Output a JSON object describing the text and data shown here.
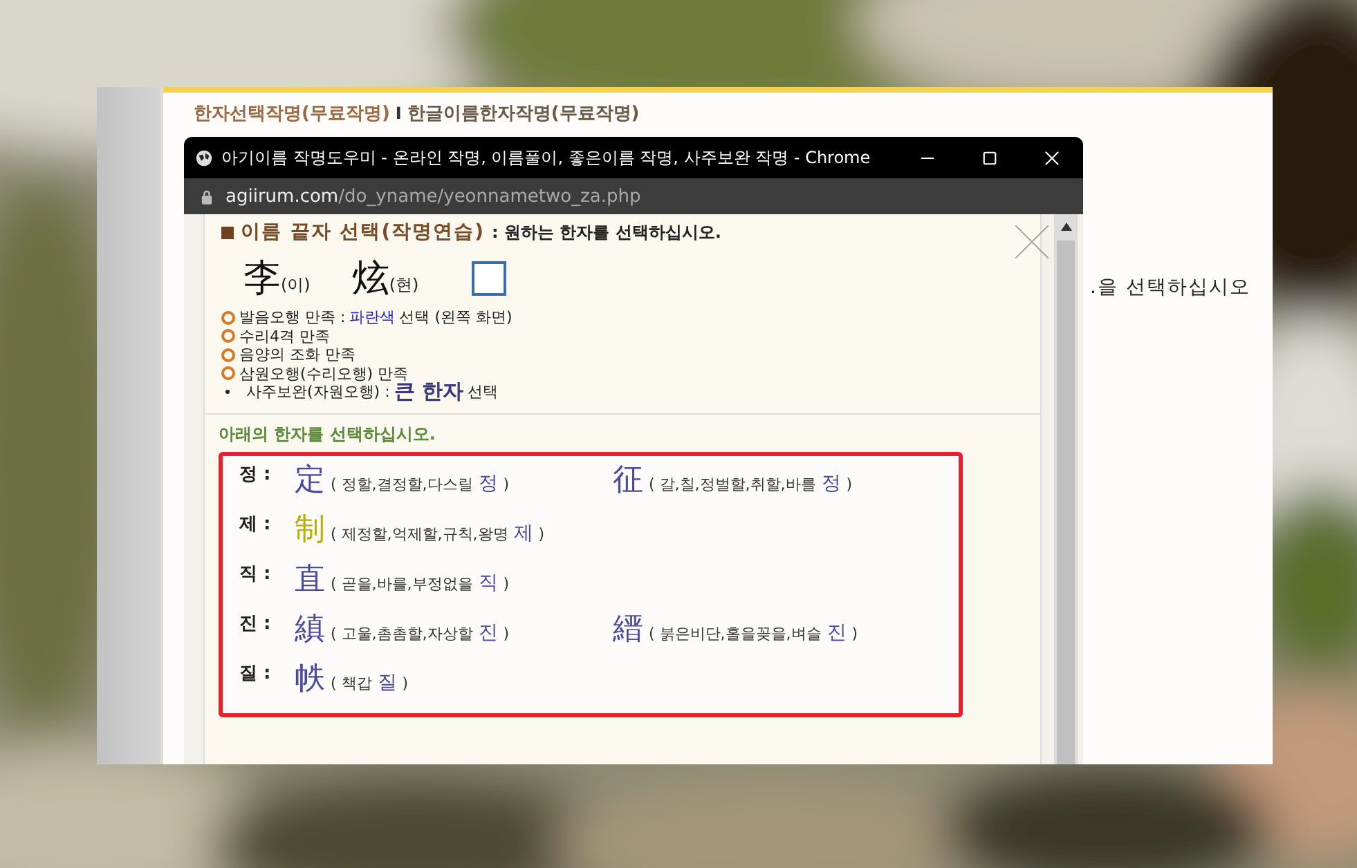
{
  "page_links": [
    {
      "label": "한자선택작명(무료작명)",
      "selected": true
    },
    {
      "label": "한글이름한자작명(무료작명)",
      "selected": false
    }
  ],
  "link_separator": "I",
  "page_side_text": ".을 선택하십시오",
  "popup": {
    "title": "아기이름 작명도우미 - 온라인 작명, 이름풀이, 좋은이름 작명, 사주보완 작명 - Chrome",
    "url_host": "agiirum.com",
    "url_path": "/do_yname/yeonnametwo_za.php"
  },
  "heading": {
    "title": "이름 끝자 선택(작명연습)",
    "subtitle": ": 원하는 한자를 선택하십시오."
  },
  "name_chars": [
    {
      "kind": "hanja",
      "hanja": "李",
      "reading": "(이)"
    },
    {
      "kind": "hanja",
      "hanja": "炫",
      "reading": "(현)"
    },
    {
      "kind": "empty"
    }
  ],
  "criteria": [
    {
      "kind": "circle",
      "parts": [
        {
          "kind": "plain",
          "text": "발음오행 만족 :"
        },
        {
          "kind": "blue",
          "text": "파란색"
        },
        {
          "kind": "plain",
          "text": "선택 (왼쪽 화면)"
        }
      ]
    },
    {
      "kind": "circle",
      "parts": [
        {
          "kind": "plain",
          "text": "수리4격 만족"
        }
      ]
    },
    {
      "kind": "circle",
      "parts": [
        {
          "kind": "plain",
          "text": "음양의 조화 만족"
        }
      ]
    },
    {
      "kind": "circle",
      "parts": [
        {
          "kind": "plain",
          "text": "삼원오행(수리오행) 만족"
        }
      ]
    },
    {
      "kind": "bullet",
      "parts": [
        {
          "kind": "plain",
          "text": "사주보완(자원오행) :"
        },
        {
          "kind": "large",
          "text": "큰 한자"
        },
        {
          "kind": "plain",
          "text": "선택"
        }
      ]
    }
  ],
  "list_heading": "아래의 한자를 선택하십시오.",
  "groups": [
    {
      "reading": "정 :",
      "options": [
        {
          "hanja": "定",
          "meaning": "( 정할,결정할,다스릴",
          "sound": "정",
          "close": ")",
          "color": "#4b4b9c"
        },
        {
          "hanja": "征",
          "meaning": "( 갈,칠,정벌할,취할,바를",
          "sound": "정",
          "close": ")",
          "color": "#4b4b9c"
        }
      ]
    },
    {
      "reading": "제 :",
      "options": [
        {
          "hanja": "制",
          "meaning": "( 제정할,억제할,규칙,왕명",
          "sound": "제",
          "close": ")",
          "color": "#b8b000"
        }
      ]
    },
    {
      "reading": "직 :",
      "options": [
        {
          "hanja": "直",
          "meaning": "( 곧을,바를,부정없을",
          "sound": "직",
          "close": ")",
          "color": "#4b4b9c"
        }
      ]
    },
    {
      "reading": "진 :",
      "options": [
        {
          "hanja": "縝",
          "meaning": "( 고울,촘촘할,자상할",
          "sound": "진",
          "close": ")",
          "color": "#4b4b9c"
        },
        {
          "hanja": "縉",
          "meaning": "( 붉은비단,홀을꽂을,벼슬",
          "sound": "진",
          "close": ")",
          "color": "#4b4b9c"
        }
      ]
    },
    {
      "reading": "질 :",
      "options": [
        {
          "hanja": "帙",
          "meaning": "( 책갑",
          "sound": "질",
          "close": ")",
          "color": "#4b4b9c"
        }
      ]
    }
  ]
}
